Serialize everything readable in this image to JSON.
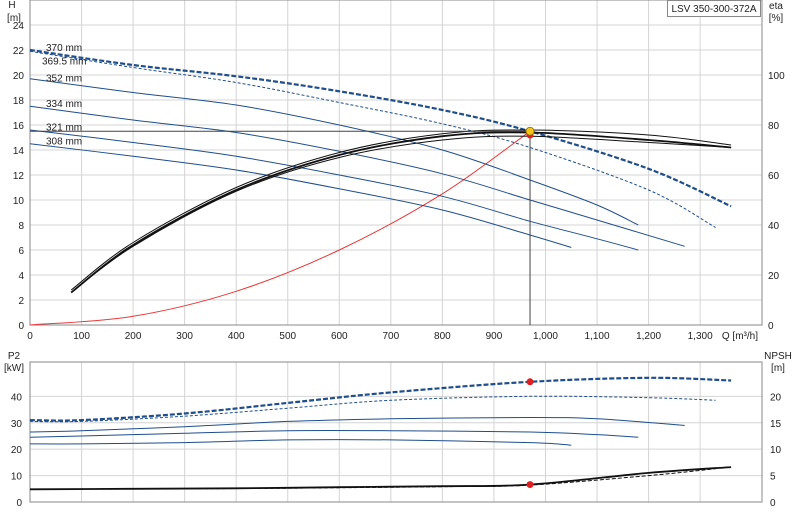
{
  "model_label": "LSV 350-300-372A",
  "chart_data": [
    {
      "type": "line",
      "panel": "head-efficiency",
      "left_axis": {
        "label_line1": "H",
        "label_line2": "[m]",
        "ylim": [
          0,
          26
        ],
        "ticks": [
          0,
          2,
          4,
          6,
          8,
          10,
          12,
          14,
          16,
          18,
          20,
          22,
          24
        ]
      },
      "right_axis": {
        "label_line1": "eta",
        "label_line2": "[%]",
        "ylim": [
          0,
          130
        ],
        "ticks": [
          0,
          20,
          40,
          60,
          80,
          100
        ]
      },
      "x_axis": {
        "label": "Q [m³/h]",
        "xlim": [
          0,
          1420
        ],
        "ticks": [
          0,
          100,
          200,
          300,
          400,
          500,
          600,
          700,
          800,
          900,
          1000,
          1100,
          1200,
          1300
        ],
        "tick_labels": [
          "0",
          "100",
          "200",
          "300",
          "400",
          "500",
          "600",
          "700",
          "800",
          "900",
          "1,000",
          "1,100",
          "1,200",
          "1,300"
        ]
      },
      "grid": true,
      "impeller_labels": [
        "370 mm",
        "369.5 mm",
        "352 mm",
        "334 mm",
        "321 mm",
        "308 mm"
      ],
      "head_curves": [
        {
          "name": "370 mm",
          "style": "bold-dashed",
          "x": [
            0,
            200,
            400,
            600,
            800,
            970,
            1200,
            1360
          ],
          "y": [
            22,
            20.8,
            19.9,
            18.7,
            17.2,
            15.5,
            12.5,
            9.5
          ]
        },
        {
          "name": "369.5 mm",
          "style": "thin-dashed",
          "x": [
            0,
            200,
            400,
            600,
            800,
            970,
            1200,
            1330
          ],
          "y": [
            21.9,
            20.6,
            19.4,
            17.8,
            16.1,
            14.2,
            10.8,
            7.8
          ]
        },
        {
          "name": "352 mm",
          "style": "solid",
          "x": [
            0,
            200,
            400,
            600,
            800,
            970,
            1100,
            1180
          ],
          "y": [
            19.7,
            18.6,
            17.6,
            16.0,
            14.0,
            11.6,
            9.6,
            8.0
          ]
        },
        {
          "name": "334 mm",
          "style": "solid",
          "x": [
            0,
            200,
            400,
            600,
            800,
            970,
            1100,
            1270
          ],
          "y": [
            17.5,
            16.4,
            15.4,
            13.9,
            12.1,
            10.0,
            8.4,
            6.3
          ]
        },
        {
          "name": "321 mm",
          "style": "solid",
          "x": [
            0,
            200,
            400,
            600,
            800,
            970,
            1100,
            1180
          ],
          "y": [
            15.6,
            14.6,
            13.5,
            12.0,
            10.3,
            8.3,
            6.9,
            6.0
          ]
        },
        {
          "name": "308 mm",
          "style": "solid",
          "x": [
            0,
            200,
            400,
            600,
            800,
            970,
            1050
          ],
          "y": [
            14.5,
            13.5,
            12.4,
            10.9,
            9.2,
            7.2,
            6.2
          ]
        }
      ],
      "efficiency_curves": [
        {
          "name": "eta-1",
          "x": [
            80,
            200,
            400,
            600,
            800,
            970,
            1200,
            1360
          ],
          "y": [
            13,
            32,
            54,
            68,
            75.5,
            77,
            74,
            71
          ]
        },
        {
          "name": "eta-2",
          "x": [
            80,
            200,
            400,
            600,
            800,
            970,
            1200,
            1360
          ],
          "y": [
            13,
            31.5,
            53.5,
            67,
            74,
            75.5,
            73,
            71
          ]
        },
        {
          "name": "eta-3",
          "x": [
            80,
            200,
            400,
            600,
            800,
            970,
            1200,
            1360
          ],
          "y": [
            14,
            33,
            55,
            69,
            76.5,
            78,
            76,
            72
          ]
        }
      ],
      "system_curve": {
        "x": [
          0,
          200,
          400,
          600,
          800,
          970
        ],
        "y": [
          0,
          0.7,
          2.7,
          6.0,
          10.5,
          15.5
        ]
      },
      "duty_point": {
        "x": 970,
        "y": 15.5
      },
      "efficiency_point": {
        "x": 970,
        "y": 76
      }
    },
    {
      "type": "line",
      "panel": "power-npsh",
      "left_axis": {
        "label_line1": "P2",
        "label_line2": "[kW]",
        "ylim": [
          0,
          53
        ],
        "ticks": [
          0,
          10,
          20,
          30,
          40
        ]
      },
      "right_axis": {
        "label_line1": "NPSH",
        "label_line2": "[m]",
        "ylim": [
          0,
          26.5
        ],
        "ticks": [
          0,
          5,
          10,
          15,
          20
        ]
      },
      "x_axis": {
        "xlim": [
          0,
          1420
        ]
      },
      "grid": true,
      "power_curves": [
        {
          "name": "370 mm",
          "style": "bold-dashed",
          "x": [
            0,
            100,
            300,
            500,
            700,
            970,
            1200,
            1360
          ],
          "y": [
            31,
            31,
            33.5,
            37.5,
            41.5,
            45.5,
            47,
            46
          ]
        },
        {
          "name": "369.5 mm",
          "style": "thin-dashed",
          "x": [
            0,
            100,
            300,
            500,
            700,
            970,
            1200,
            1330
          ],
          "y": [
            30.5,
            30.5,
            32.5,
            35.5,
            38.5,
            40,
            39.5,
            38.5
          ]
        },
        {
          "name": "352 mm",
          "style": "solid",
          "x": [
            0,
            100,
            300,
            500,
            700,
            970,
            1100,
            1270
          ],
          "y": [
            26.5,
            27,
            28.5,
            30.5,
            31.5,
            32,
            31.5,
            29
          ]
        },
        {
          "name": "334 mm",
          "style": "solid",
          "x": [
            0,
            100,
            300,
            500,
            700,
            970,
            1100,
            1180
          ],
          "y": [
            24.5,
            25,
            26,
            27,
            27,
            26.5,
            25.5,
            24.5
          ]
        },
        {
          "name": "308 mm",
          "style": "solid",
          "x": [
            0,
            100,
            300,
            500,
            700,
            970,
            1050
          ],
          "y": [
            22,
            22,
            22.5,
            23.5,
            23.5,
            22.5,
            21.5
          ]
        }
      ],
      "npsh_curves": [
        {
          "name": "npsh-1",
          "x": [
            0,
            200,
            400,
            600,
            800,
            970,
            1200,
            1360
          ],
          "y": [
            2.4,
            2.5,
            2.6,
            2.8,
            3.0,
            3.3,
            5.5,
            6.6
          ]
        },
        {
          "name": "npsh-2",
          "x": [
            0,
            200,
            400,
            600,
            800,
            970,
            1200,
            1330
          ],
          "y": [
            2.4,
            2.5,
            2.55,
            2.7,
            2.9,
            3.2,
            5.0,
            6.3
          ]
        }
      ],
      "power_point": {
        "x": 970,
        "y": 45.5
      },
      "npsh_point": {
        "x": 970,
        "y": 3.3
      }
    }
  ],
  "colors": {
    "curve_blue": "#1f4e8c",
    "efficiency_black": "#111111",
    "system_red": "#e8383a",
    "duty_point": "#f5c518",
    "marker_red": "#e02020",
    "grid": "#d4d4d4",
    "frame": "#888888"
  }
}
